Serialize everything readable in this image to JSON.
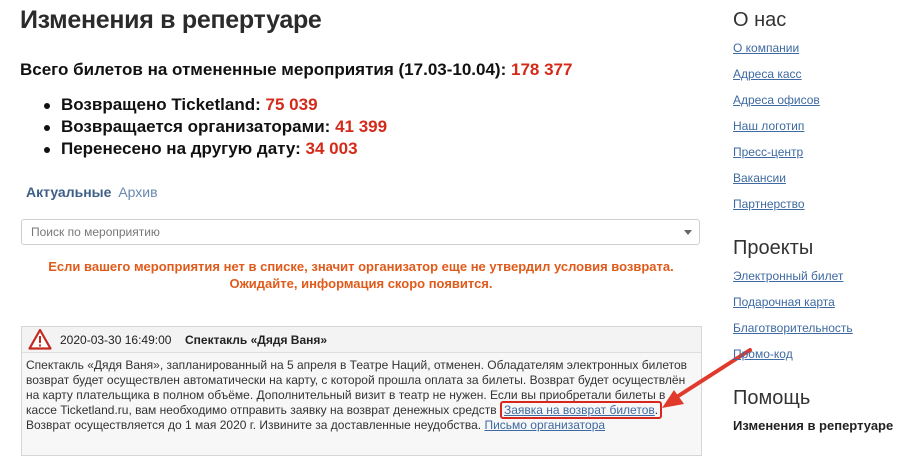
{
  "main": {
    "title": "Изменения в репертуаре",
    "summary": {
      "label": "Всего билетов на отмененные мероприятия (17.03-10.04):",
      "value": "178 377"
    },
    "stats": [
      {
        "label": "Возвращено Ticketland:",
        "value": "75 039"
      },
      {
        "label": "Возвращается организаторами:",
        "value": "41 399"
      },
      {
        "label": "Перенесено на другую дату:",
        "value": "34 003"
      }
    ],
    "tabs": {
      "active": "Актуальные",
      "archive": "Архив"
    },
    "search": {
      "placeholder": "Поиск по мероприятию",
      "icon": "chevron-down-icon"
    },
    "notice": "Если вашего мероприятия нет в списке, значит организатор еще не утвердил условия возврата. Ожидайте, информация скоро появится.",
    "event": {
      "icon": "warning-icon",
      "date": "2020-03-30 16:49:00",
      "title": "Спектакль «Дядя Ваня»",
      "line1": "Спектакль «Дядя Ваня», запланированный на 5 апреля в Театре Наций, отменен. Обладателям электронных билетов",
      "line2": "возврат будет осуществлен автоматически на карту, с которой прошла оплата за билеты. Возврат будет осуществлён",
      "line3": "на карту плательщика в полном объёме. Дополнительный визит в театр не нужен. Если вы приобретали билеты в",
      "line4_text": "кассе Ticketland.ru, вам необходимо отправить заявку на возврат денежных средств",
      "refund_link": "Заявка на возврат билетов",
      "line4_end": ".",
      "line5_text": "Возврат осуществляется до 1 мая 2020 г. Извините за доставленные неудобства.",
      "letter_link": "Письмо организатора"
    },
    "colors": {
      "accent_red": "#d42a1a",
      "notice_orange": "#e05b1b",
      "link_blue": "#3e6aa1"
    }
  },
  "sidebar": {
    "about": {
      "title": "О нас",
      "links": [
        "О компании",
        "Адреса касс",
        "Адреса офисов",
        "Наш логотип",
        "Пресс-центр",
        "Вакансии",
        "Партнерство"
      ]
    },
    "projects": {
      "title": "Проекты",
      "links": [
        "Электронный билет",
        "Подарочная карта",
        "Благотворительность",
        "Промо-код"
      ]
    },
    "help": {
      "title": "Помощь",
      "current": "Изменения в репертуаре"
    }
  }
}
